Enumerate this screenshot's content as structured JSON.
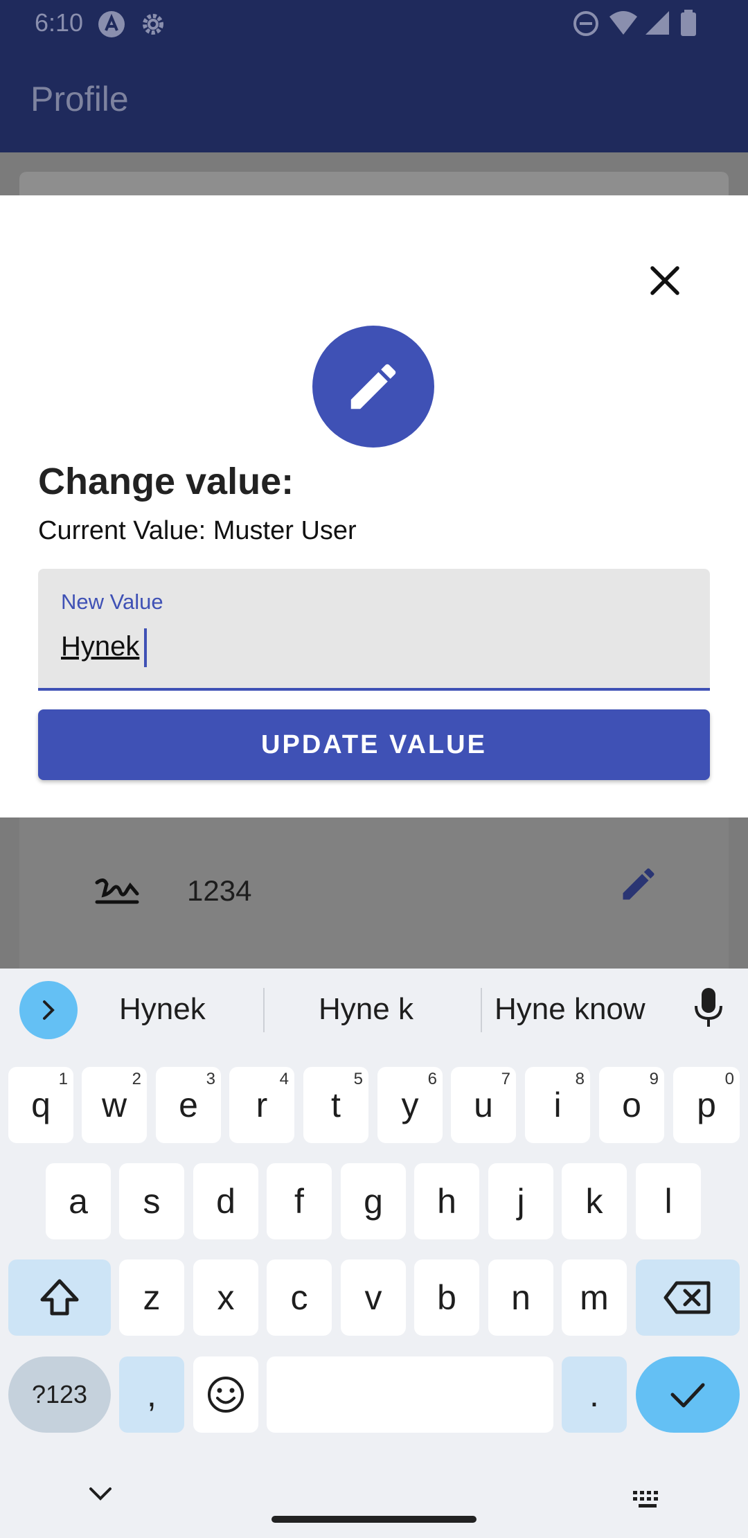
{
  "status_bar": {
    "time": "6:10",
    "icons": [
      "a-logo-icon",
      "settings-gear-icon",
      "do-not-disturb-icon",
      "wifi-icon",
      "signal-icon",
      "battery-icon"
    ]
  },
  "app_bar": {
    "title": "Profile"
  },
  "dialog": {
    "title": "Change value:",
    "current_value_label": "Current Value:",
    "current_value": "Muster User",
    "input": {
      "label": "New Value",
      "value": "Hynek"
    },
    "update_button": "UPDATE VALUE",
    "close_icon": "close-icon",
    "header_icon": "pencil-icon"
  },
  "background_row": {
    "value": "1234",
    "icon": "signature-icon",
    "edit_icon": "pencil-icon"
  },
  "keyboard": {
    "suggestions": [
      "Hynek",
      "Hyne k",
      "Hyne know"
    ],
    "row1": [
      {
        "k": "q",
        "h": "1"
      },
      {
        "k": "w",
        "h": "2"
      },
      {
        "k": "e",
        "h": "3"
      },
      {
        "k": "r",
        "h": "4"
      },
      {
        "k": "t",
        "h": "5"
      },
      {
        "k": "y",
        "h": "6"
      },
      {
        "k": "u",
        "h": "7"
      },
      {
        "k": "i",
        "h": "8"
      },
      {
        "k": "o",
        "h": "9"
      },
      {
        "k": "p",
        "h": "0"
      }
    ],
    "row2": [
      "a",
      "s",
      "d",
      "f",
      "g",
      "h",
      "j",
      "k",
      "l"
    ],
    "row3": [
      "z",
      "x",
      "c",
      "v",
      "b",
      "n",
      "m"
    ],
    "symbols_key": "?123",
    "comma_key": ",",
    "period_key": "."
  },
  "colors": {
    "primary": "#3f51b5",
    "appbar_dim": "#1f2a5c",
    "keyboard_accent": "#64c0f4"
  }
}
